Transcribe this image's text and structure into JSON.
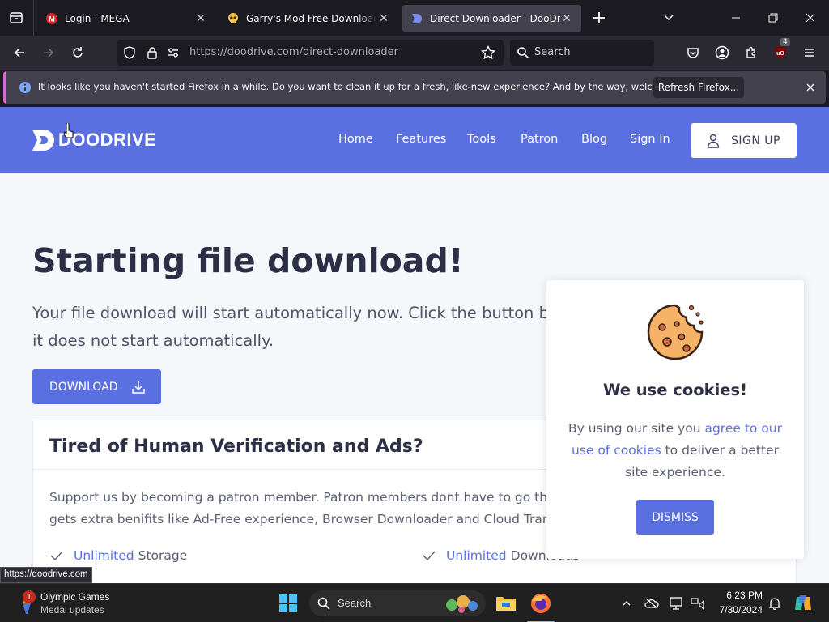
{
  "browser": {
    "tabs": [
      {
        "title": "Login - MEGA",
        "active": false
      },
      {
        "title": "Garry's Mod Free Download (Bu",
        "active": false
      },
      {
        "title": "Direct Downloader - DooDrive",
        "active": true
      }
    ],
    "url_host": "https://doodrive.com",
    "url_path": "/direct-downloader",
    "search_placeholder": "Search",
    "extension_badge": "4",
    "notification": {
      "message": "It looks like you haven't started Firefox in a while. Do you want to clean it up for a fresh, like-new experience? And by the way, welcome back!",
      "button": "Refresh Firefox..."
    },
    "status_url": "https://doodrive.com"
  },
  "site": {
    "logo_text": "DOODRIVE",
    "nav": [
      "Home",
      "Features",
      "Tools",
      "Patron",
      "Blog",
      "Sign In"
    ],
    "signup_label": "SIGN UP",
    "heading": "Starting file download!",
    "subtext": "Your file download will start automatically now. Click the button below if it does not start automatically.",
    "download_label": "DOWNLOAD",
    "patron_card": {
      "title": "Tired of Human Verification and Ads?",
      "line1": "Support us by becoming a patron member. Patron members dont have to go through human verification and",
      "line2": "gets extra benifits like Ad-Free experience, Browser Downloader and Cloud Transfer.",
      "features": [
        {
          "highlight": "Unlimited",
          "rest": "Storage"
        },
        {
          "highlight": "Unlimited",
          "rest": "Downloads"
        }
      ]
    },
    "cookie": {
      "title": "We use cookies!",
      "text_before": "By using our site you",
      "link": "agree to our use of cookies",
      "text_after": "to deliver a better site experience.",
      "dismiss_label": "DISMISS"
    }
  },
  "taskbar": {
    "widget_title": "Olympic Games",
    "widget_subtitle": "Medal updates",
    "widget_badge": "1",
    "search_placeholder": "Search",
    "time": "6:23 PM",
    "date": "7/30/2024"
  },
  "colors": {
    "brand": "#5b70e0",
    "browser_bg": "#1c1b22",
    "toolbar": "#2b2a33",
    "notification_accent": "#d46bd6"
  }
}
